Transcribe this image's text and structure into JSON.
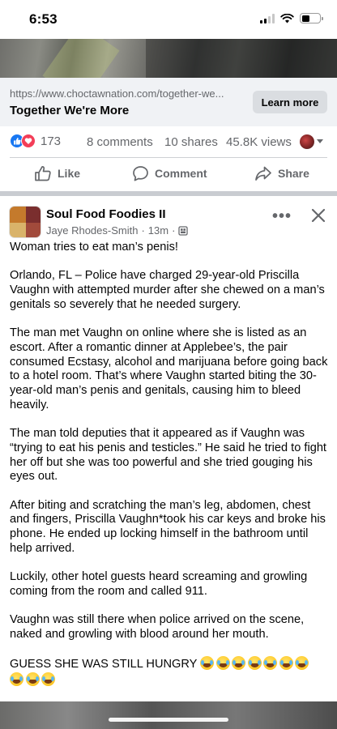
{
  "status_bar": {
    "time": "6:53"
  },
  "link_preview": {
    "url": "https://www.choctawnation.com/together-we...",
    "title": "Together We're More",
    "cta": "Learn more"
  },
  "stats": {
    "reaction_count": "173",
    "comments": "8 comments",
    "shares": "10 shares",
    "views": "45.8K views"
  },
  "actions": {
    "like": "Like",
    "comment": "Comment",
    "share": "Share"
  },
  "post": {
    "page_name": "Soul Food Foodies II",
    "author": "Jaye Rhodes-Smith",
    "separator": "·",
    "time": "13m",
    "paragraphs": [
      "Woman tries to eat man’s penis!",
      "Orlando, FL – Police have charged 29-year-old Priscilla Vaughn with attempted murder after she chewed on a man’s genitals so severely that he needed surgery.",
      "The man met Vaughn on online where she is listed as an escort. After a romantic dinner at Applebee’s, the pair consumed Ecstasy, alcohol and marijuana before going back to a hotel room. That’s where Vaughn started biting the 30-year-old man’s penis and genitals, causing him to bleed heavily.",
      "The man told deputies that it appeared as if Vaughn was “trying to eat his penis and testicles.” He said he tried to fight her off but she was too powerful and she tried gouging his eyes out.",
      "After biting and scratching the man’s leg, abdomen, chest and fingers, Priscilla Vaughn*took his car keys and broke his phone. He ended up locking himself in the bathroom until help arrived.",
      "Luckily, other hotel guests heard screaming and growling coming from the room and called 911.",
      "Vaughn was still there when police arrived on the scene, naked and growling with blood around her mouth."
    ],
    "closing": "GUESS SHE WAS STILL HUNGRY",
    "emoji_name": "face-with-tears-of-joy",
    "emoji_count": 10
  },
  "colors": {
    "accent": "#1877f2",
    "love": "#f33e58",
    "muted": "#65676b",
    "card_bg": "#f0f2f5"
  }
}
